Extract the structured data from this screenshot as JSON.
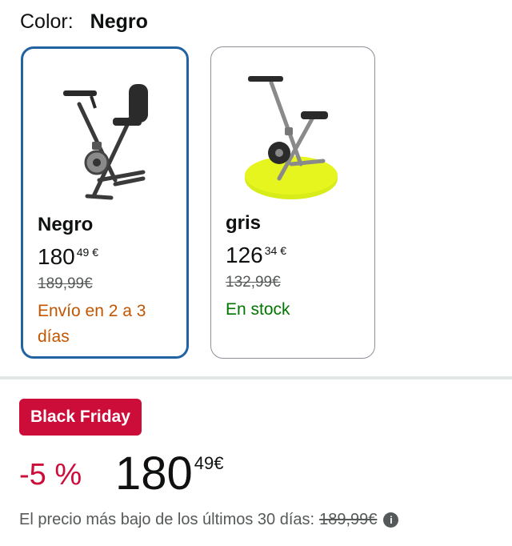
{
  "color": {
    "label": "Color:",
    "selected": "Negro"
  },
  "options": [
    {
      "name": "Negro",
      "price_whole": "180",
      "price_fraction": "49",
      "currency": "€",
      "old_price": "189,99€",
      "availability": "Envío en 2 a 3 días",
      "selected": true
    },
    {
      "name": "gris",
      "price_whole": "126",
      "price_fraction": "34",
      "currency": "€",
      "old_price": "132,99€",
      "availability": "En stock",
      "selected": false
    }
  ],
  "deal": {
    "badge": "Black Friday",
    "discount": "-5 %",
    "price_whole": "180",
    "price_fraction": "49",
    "currency": "€",
    "lowest_text": "El precio más bajo de los últimos 30 días:",
    "lowest_price": "189,99€",
    "info_icon": "info-icon"
  },
  "colors": {
    "accent_red": "#cc0c39",
    "selected_border": "#2162a1",
    "shipping": "#c45500",
    "stock": "#007600"
  }
}
